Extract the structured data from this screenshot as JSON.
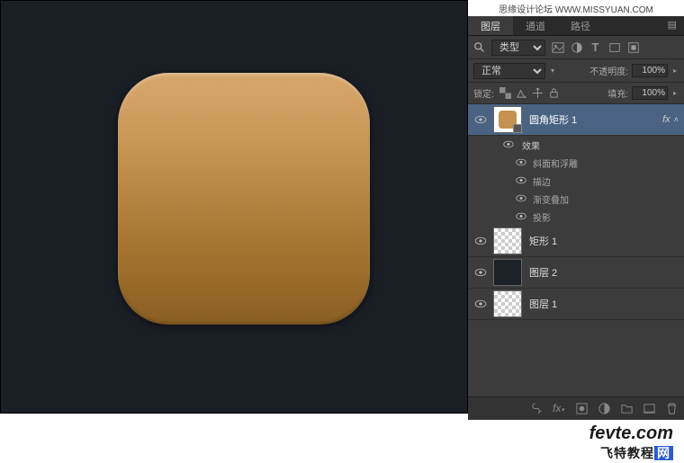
{
  "watermark": "思缘设计论坛  WWW.MISSYUAN.COM",
  "tabs": {
    "layers": "图层",
    "channels": "通道",
    "paths": "路径"
  },
  "filter": {
    "type_label": "类型"
  },
  "blend": {
    "mode": "正常",
    "opacity_label": "不透明度:",
    "opacity_value": "100%"
  },
  "lock": {
    "label": "锁定:",
    "fill_label": "填充:",
    "fill_value": "100%"
  },
  "layers": [
    {
      "name": "圆角矩形 1",
      "fx": "fx"
    },
    {
      "name": "矩形 1"
    },
    {
      "name": "图层 2"
    },
    {
      "name": "图层 1"
    }
  ],
  "effects": {
    "header": "效果",
    "items": [
      "斜面和浮雕",
      "描边",
      "渐变叠加",
      "投影"
    ]
  },
  "logo": {
    "main": "fevte.com",
    "sub_pre": "飞特教程",
    "sub_accent": "网"
  }
}
